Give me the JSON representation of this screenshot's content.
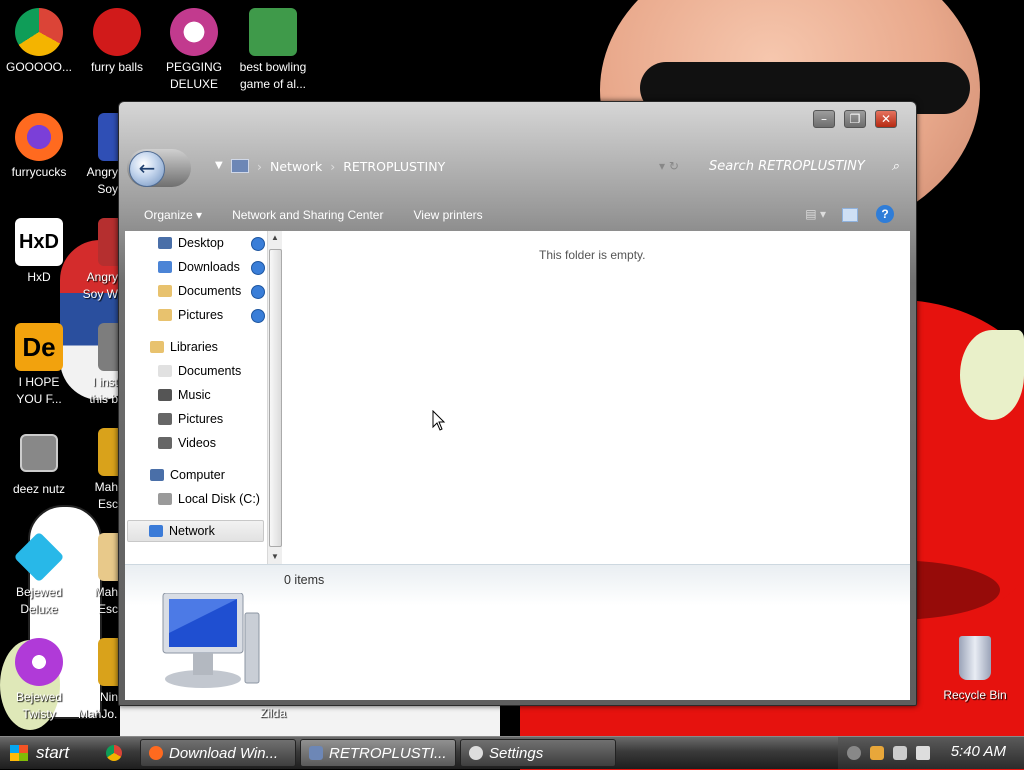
{
  "desktop": {
    "icons": [
      {
        "label": "GOOOOO...",
        "color": "#4285f4"
      },
      {
        "label": "furry balls",
        "color": "#d11a1a"
      },
      {
        "label": "PEGGING\nDELUXE",
        "color": "#c23a8e"
      },
      {
        "label": "best bowling\ngame of al...",
        "color": "#3f9a4a"
      },
      {
        "label": "furrycucks",
        "color": "#ff6a1f"
      },
      {
        "label": "Angry\nSoy",
        "color": "#2f4fb5"
      },
      {
        "label": "HxD",
        "color": "#ffffff"
      },
      {
        "label": "Angry\nSoy W",
        "color": "#b52f2f"
      },
      {
        "label": "I HOPE\nYOU F...",
        "color": "#f2a20d"
      },
      {
        "label": "I inst\nthis b",
        "color": "#7d7d7d"
      },
      {
        "label": "deez nutz",
        "color": "#888888"
      },
      {
        "label": "Mah\nEsc",
        "color": "#d9a21b"
      },
      {
        "label": "Bejewed\nDeluxe",
        "color": "#28b8e8"
      },
      {
        "label": "Mah\nEsc",
        "color": "#e8c98a"
      },
      {
        "label": "Bejewed\nTwisty",
        "color": "#b03ad8"
      },
      {
        "label": "Nin\nMahJo...",
        "color": "#d9a21b"
      },
      {
        "label": "Zilda",
        "color": "#888888"
      },
      {
        "label": "Recycle Bin",
        "color": "#c8ccd8"
      }
    ]
  },
  "window": {
    "controls": {
      "minimize": "–",
      "maximize": "❐",
      "close": "✕"
    },
    "address": {
      "crumb1": "Network",
      "crumb2": "RETROPLUSTINY",
      "sep": "›"
    },
    "search": {
      "placeholder": "Search RETROPLUSTINY",
      "icon": "search-icon"
    },
    "toolbar": {
      "organize": "Organize ▾",
      "network_sharing": "Network and Sharing Center",
      "view_printers": "View printers",
      "views_glyph": "▤ ▾",
      "help": "?"
    },
    "nav": {
      "favorites": [
        {
          "label": "Desktop",
          "icon_color": "#4a6fa8"
        },
        {
          "label": "Downloads",
          "icon_color": "#4b84d6"
        },
        {
          "label": "Documents",
          "icon_color": "#e8c26e"
        },
        {
          "label": "Pictures",
          "icon_color": "#e8c26e"
        }
      ],
      "libraries": {
        "label": "Libraries",
        "icon_color": "#e8c26e"
      },
      "library_items": [
        {
          "label": "Documents",
          "icon_color": "#e1e1e1"
        },
        {
          "label": "Music",
          "icon_color": "#555555"
        },
        {
          "label": "Pictures",
          "icon_color": "#666666"
        },
        {
          "label": "Videos",
          "icon_color": "#666666"
        }
      ],
      "computer": {
        "label": "Computer",
        "icon_color": "#4a6fa8"
      },
      "local_disk": {
        "label": "Local Disk (C:)",
        "icon_color": "#9a9a9a"
      },
      "network": {
        "label": "Network",
        "icon_color": "#3b7bd8"
      }
    },
    "main": {
      "empty_text": "This folder is empty."
    },
    "details": {
      "count": "0 items"
    }
  },
  "taskbar": {
    "start": "start",
    "tasks": [
      {
        "label": "Download Win...",
        "icon_color": "#ff6a1f"
      },
      {
        "label": "RETROPLUSTI...",
        "icon_color": "#6d87b6"
      },
      {
        "label": "Settings",
        "icon_color": "#dddddd"
      }
    ],
    "clock": "5:40 AM"
  }
}
